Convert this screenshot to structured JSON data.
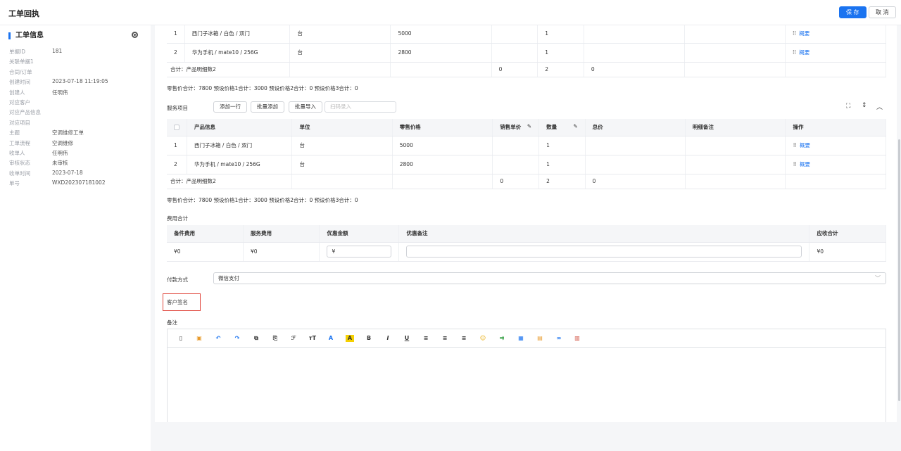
{
  "header": {
    "title": "工单回执",
    "save_label": "保 存",
    "cancel_label": "取 消"
  },
  "sidebar": {
    "title": "工单信息",
    "rows": [
      {
        "k": "单据ID",
        "v": "181"
      },
      {
        "k": "关联单据1",
        "v": ""
      },
      {
        "k": "合同/订单",
        "v": ""
      },
      {
        "k": "创建时间",
        "v": "2023-07-18 11:19:05"
      },
      {
        "k": "创建人",
        "v": "任明伟"
      },
      {
        "k": "对应客户",
        "v": ""
      },
      {
        "k": "对应产品信息",
        "v": ""
      },
      {
        "k": "对应项目",
        "v": ""
      },
      {
        "k": "主题",
        "v": "空调维修工单"
      },
      {
        "k": "工单流程",
        "v": "空调维修"
      },
      {
        "k": "收单人",
        "v": "任明伟"
      },
      {
        "k": "审核状态",
        "v": "未审核"
      },
      {
        "k": "收单时间",
        "v": "2023-07-18"
      },
      {
        "k": "单号",
        "v": "WXD202307181002"
      }
    ]
  },
  "products": {
    "rows": [
      {
        "idx": "1",
        "name": "西门子冰箱 / 白色 / 双门",
        "unit": "台",
        "price": "5000",
        "sale": "",
        "qty": "1",
        "total": "",
        "note": "",
        "action": "概要"
      },
      {
        "idx": "2",
        "name": "华为手机 / mate10 / 256G",
        "unit": "台",
        "price": "2800",
        "sale": "",
        "qty": "1",
        "total": "",
        "note": "",
        "action": "概要"
      }
    ],
    "sum": {
      "label": "合计：产品明细数2",
      "sale": "0",
      "qty": "2",
      "total": "0"
    },
    "summary": "零售价合计：7800  预设价格1合计：3000  预设价格2合计：0  预设价格3合计：0"
  },
  "service": {
    "label": "服务项目",
    "add_row": "添加一行",
    "batch_add": "批量添加",
    "batch_import": "批量导入",
    "scan_placeholder": "扫码录入",
    "headers": [
      "产品信息",
      "单位",
      "零售价格",
      "销售单价",
      "数量",
      "总价",
      "明细备注",
      "操作"
    ],
    "rows": [
      {
        "idx": "1",
        "name": "西门子冰箱 / 白色 / 双门",
        "unit": "台",
        "price": "5000",
        "sale": "",
        "qty": "1",
        "total": "",
        "note": "",
        "action": "概要"
      },
      {
        "idx": "2",
        "name": "华为手机 / mate10 / 256G",
        "unit": "台",
        "price": "2800",
        "sale": "",
        "qty": "1",
        "total": "",
        "note": "",
        "action": "概要"
      }
    ],
    "sum": {
      "label": "合计：产品明细数2",
      "sale": "0",
      "qty": "2",
      "total": "0"
    },
    "summary": "零售价合计：7800  预设价格1合计：3000  预设价格2合计：0  预设价格3合计：0"
  },
  "fees": {
    "label": "费用合计",
    "headers": [
      "备件费用",
      "服务费用",
      "优惠金额",
      "优惠备注",
      "应收合计"
    ],
    "parts": "¥0",
    "service": "¥0",
    "discount": "¥",
    "remark": "",
    "receivable": "¥0"
  },
  "payment": {
    "label": "付款方式",
    "value": "微信支付"
  },
  "signature": {
    "label": "客户签名"
  },
  "remarks": {
    "label": "备注"
  },
  "colors": {
    "primary": "#1a73f0",
    "highlight": "#e0473d"
  }
}
